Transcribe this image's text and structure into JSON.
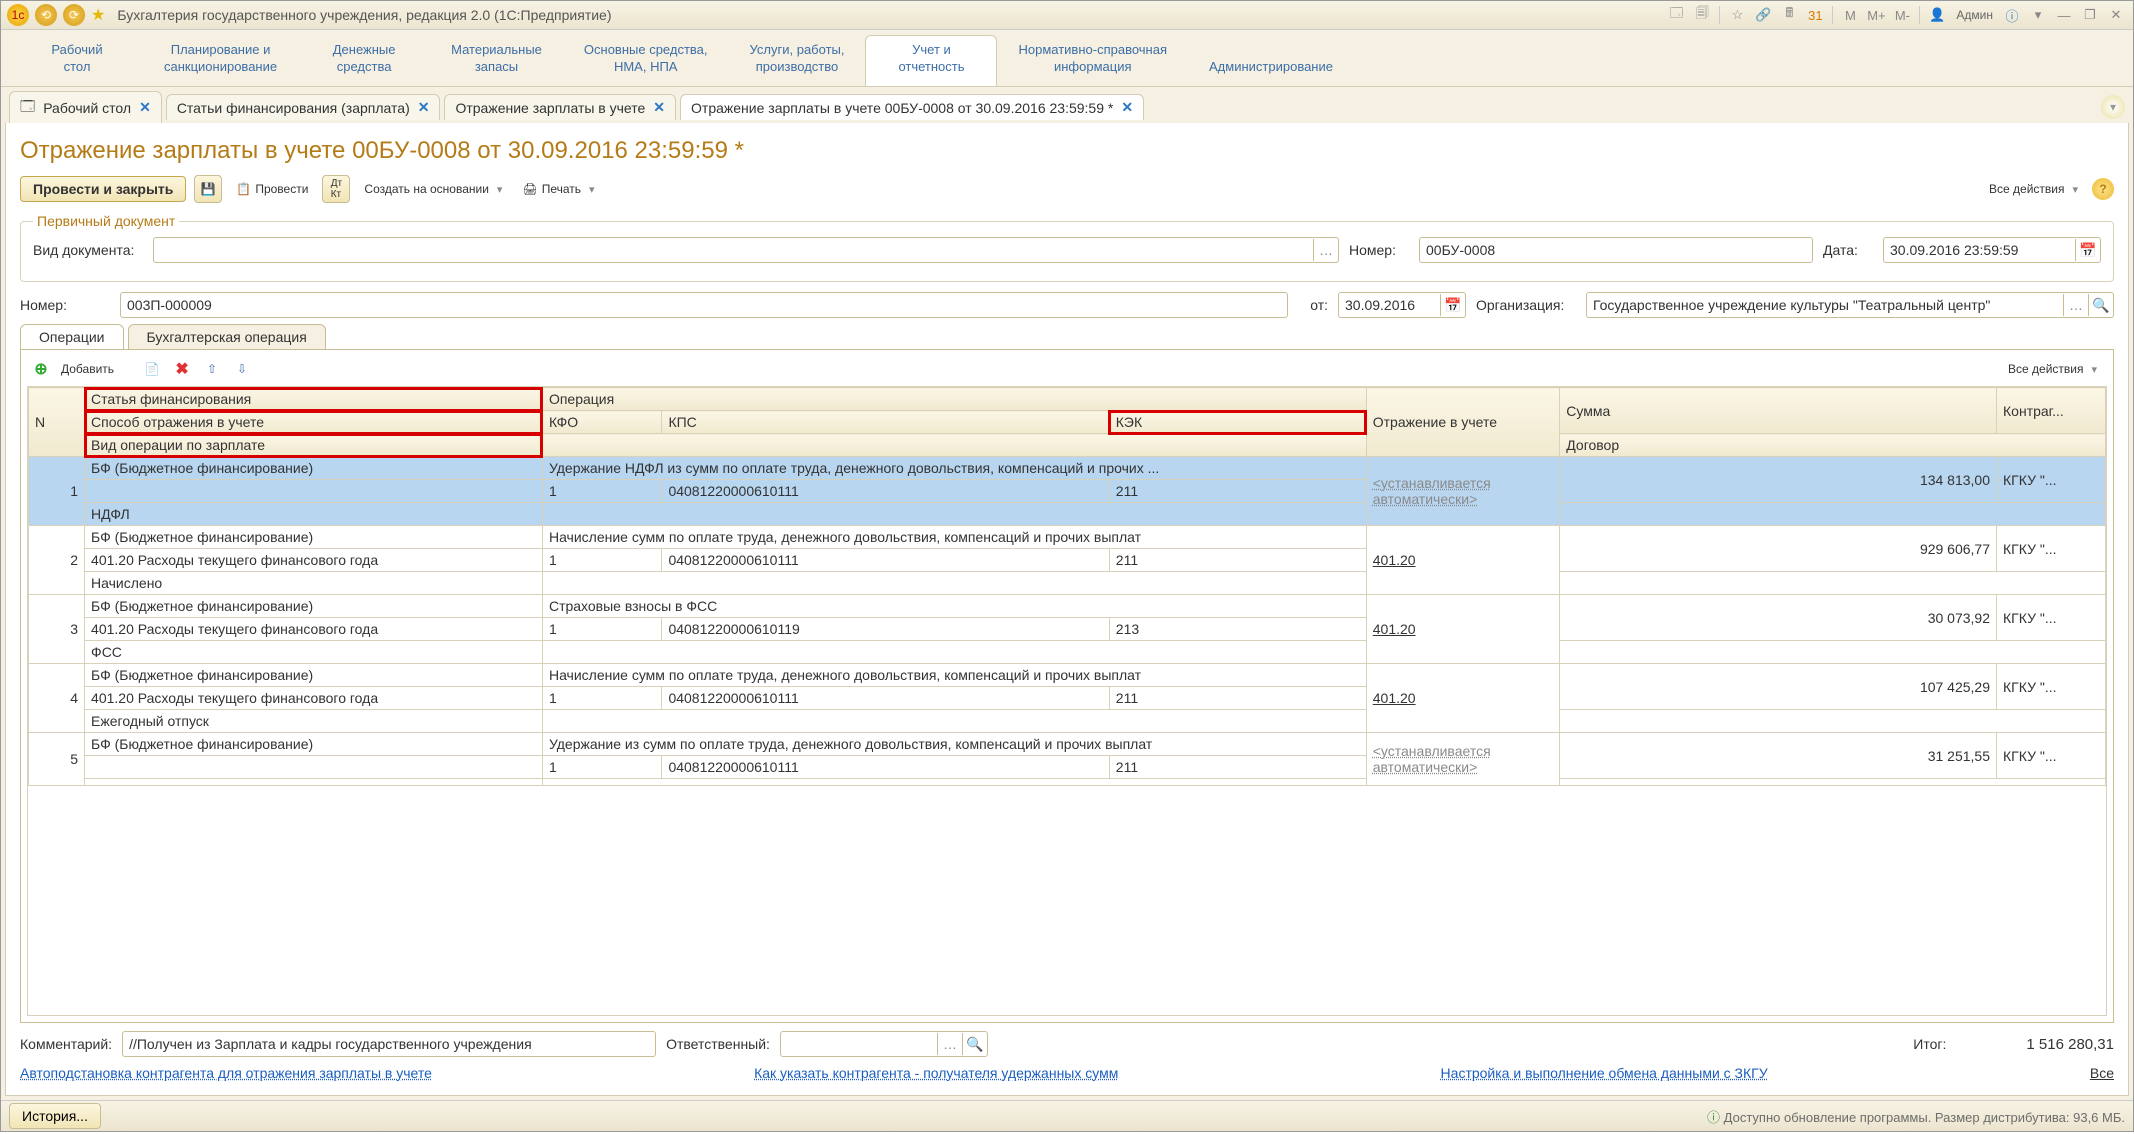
{
  "app_title": "Бухгалтерия государственного учреждения, редакция 2.0  (1С:Предприятие)",
  "user_label": "Админ",
  "nav": [
    "Рабочий\nстол",
    "Планирование и\nсанкционирование",
    "Денежные\nсредства",
    "Материальные\nзапасы",
    "Основные средства,\nНМА, НПА",
    "Услуги, работы,\nпроизводство",
    "Учет и\nотчетность",
    "Нормативно-справочная\nинформация",
    "Администрирование"
  ],
  "nav_active": 6,
  "open_tabs": [
    {
      "label": "Рабочий стол",
      "icon": "desktop"
    },
    {
      "label": "Статьи финансирования (зарплата)"
    },
    {
      "label": "Отражение зарплаты в учете"
    },
    {
      "label": "Отражение зарплаты в учете 00БУ-0008 от 30.09.2016 23:59:59 *",
      "active": true
    }
  ],
  "page_title": "Отражение зарплаты в учете 00БУ-0008 от 30.09.2016 23:59:59 *",
  "toolbar": {
    "post_close": "Провести и закрыть",
    "post": "Провести",
    "create_based": "Создать на основании",
    "print": "Печать",
    "all_actions": "Все действия"
  },
  "primary_legend": "Первичный документ",
  "labels": {
    "doc_type": "Вид документа:",
    "number": "Номер:",
    "date": "Дата:",
    "number2": "Номер:",
    "from": "от:",
    "org": "Организация:",
    "comment": "Комментарий:",
    "responsible": "Ответственный:",
    "total": "Итог:"
  },
  "fields": {
    "doc_type": "",
    "number": "00БУ-0008",
    "date": "30.09.2016 23:59:59",
    "number2": "003П-000009",
    "from": "30.09.2016",
    "org": "Государственное учреждение культуры \"Театральный центр\"",
    "comment": "//Получен из Зарплата и кадры государственного учреждения",
    "responsible": "",
    "total": "1 516 280,31"
  },
  "inner_tabs": [
    "Операции",
    "Бухгалтерская операция"
  ],
  "tbl_toolbar": {
    "add": "Добавить",
    "all_actions": "Все действия"
  },
  "grid_headers": {
    "n": "N",
    "fin_article": "Статья финансирования",
    "operation": "Операция",
    "reflection": "Отражение в учете",
    "sum": "Сумма",
    "counterparty": "Контраг...",
    "reflect_method": "Способ отражения в учете",
    "kfo": "КФО",
    "kps": "КПС",
    "kek": "КЭК",
    "contract": "Договор",
    "salary_op": "Вид операции по зарплате"
  },
  "rows": [
    {
      "n": 1,
      "fin": "БФ (Бюджетное финансирование)",
      "method": "",
      "salary_op": "НДФЛ",
      "op": "Удержание НДФЛ из сумм по оплате труда, денежного довольствия, компенсаций и прочих ...",
      "kfo": "1",
      "kps": "04081220000610111",
      "kek": "211",
      "refl": "<устанавливается автоматически>",
      "sum": "134 813,00",
      "cp": "КГКУ \"..."
    },
    {
      "n": 2,
      "fin": "БФ (Бюджетное финансирование)",
      "method": "401.20 Расходы текущего финансового года",
      "salary_op": "Начислено",
      "op": "Начисление сумм по оплате труда, денежного довольствия, компенсаций и прочих выплат",
      "kfo": "1",
      "kps": "04081220000610111",
      "kek": "211",
      "refl": "401.20",
      "sum": "929 606,77",
      "cp": "КГКУ \"..."
    },
    {
      "n": 3,
      "fin": "БФ (Бюджетное финансирование)",
      "method": "401.20 Расходы текущего финансового года",
      "salary_op": "ФСС",
      "op": "Страховые взносы в ФСС",
      "kfo": "1",
      "kps": "04081220000610119",
      "kek": "213",
      "refl": "401.20",
      "sum": "30 073,92",
      "cp": "КГКУ \"..."
    },
    {
      "n": 4,
      "fin": "БФ (Бюджетное финансирование)",
      "method": "401.20 Расходы текущего финансового года",
      "salary_op": "Ежегодный отпуск",
      "op": "Начисление сумм по оплате труда, денежного довольствия, компенсаций и прочих выплат",
      "kfo": "1",
      "kps": "04081220000610111",
      "kek": "211",
      "refl": "401.20",
      "sum": "107 425,29",
      "cp": "КГКУ \"..."
    },
    {
      "n": 5,
      "fin": "БФ (Бюджетное финансирование)",
      "method": "",
      "salary_op": "",
      "op": "Удержание из сумм по оплате труда, денежного довольствия, компенсаций и прочих выплат",
      "kfo": "1",
      "kps": "04081220000610111",
      "kek": "211",
      "refl": "<устанавливается автоматически>",
      "sum": "31 251,55",
      "cp": "КГКУ \"..."
    }
  ],
  "footer_links": {
    "l1": "Автоподстановка контрагента для отражения зарплаты в учете",
    "l2": "Как указать контрагента - получателя удержанных сумм",
    "l3": "Настройка и выполнение обмена данными с ЗКГУ",
    "all": "Все"
  },
  "history_btn": "История...",
  "status_text": "Доступно обновление программы. Размер дистрибутива: 93,6 МБ."
}
